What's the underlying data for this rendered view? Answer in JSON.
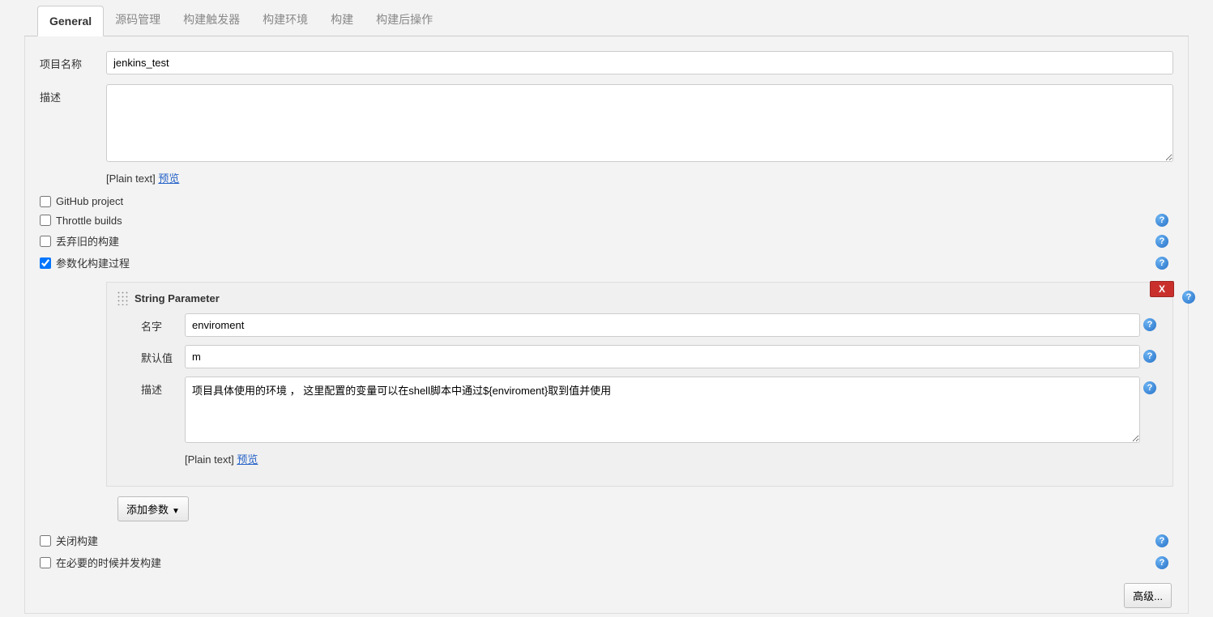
{
  "tabs": [
    {
      "label": "General",
      "active": true
    },
    {
      "label": "源码管理",
      "active": false
    },
    {
      "label": "构建触发器",
      "active": false
    },
    {
      "label": "构建环境",
      "active": false
    },
    {
      "label": "构建",
      "active": false
    },
    {
      "label": "构建后操作",
      "active": false
    }
  ],
  "project": {
    "name_label": "项目名称",
    "name_value": "jenkins_test",
    "desc_label": "描述",
    "desc_value": "",
    "plain_text_label": "[Plain text]",
    "preview_label": "预览"
  },
  "options": [
    {
      "label": "GitHub project",
      "checked": false,
      "help": false
    },
    {
      "label": "Throttle builds",
      "checked": false,
      "help": true
    },
    {
      "label": "丢弃旧的构建",
      "checked": false,
      "help": true
    },
    {
      "label": "参数化构建过程",
      "checked": true,
      "help": true
    }
  ],
  "parameter": {
    "type_label": "String Parameter",
    "delete_label": "X",
    "fields": {
      "name_label": "名字",
      "name_value": "enviroment",
      "default_label": "默认值",
      "default_value": "m",
      "desc_label": "描述",
      "desc_value": "项目具体使用的环境 ， 这里配置的变量可以在shell脚本中通过${enviroment}取到值并使用",
      "plain_text_label": "[Plain text]",
      "preview_label": "预览"
    },
    "add_param_label": "添加参数"
  },
  "footer_options": [
    {
      "label": "关闭构建",
      "checked": false
    },
    {
      "label": "在必要的时候并发构建",
      "checked": false
    }
  ],
  "advanced_btn": "高级..."
}
